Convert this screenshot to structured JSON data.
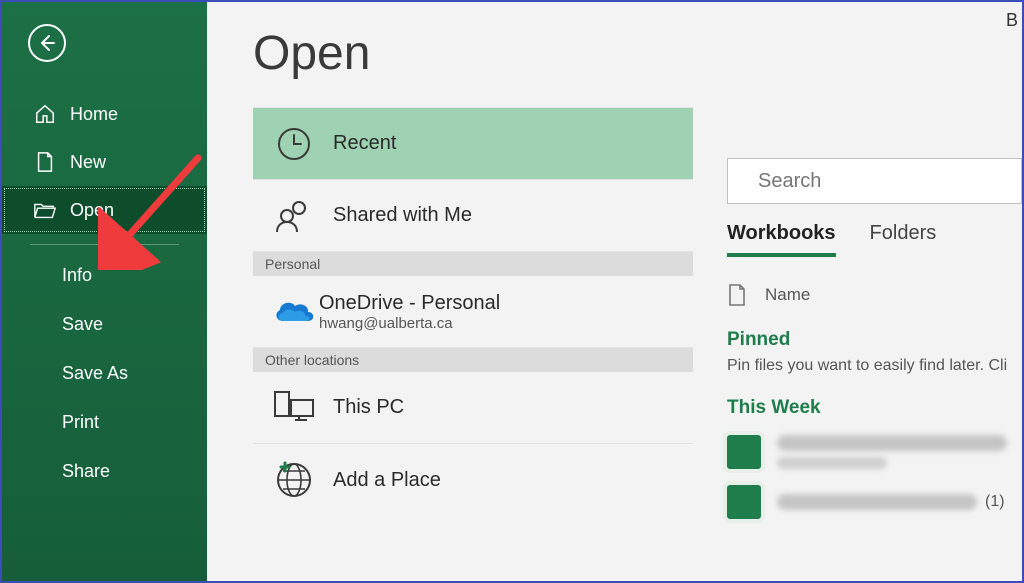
{
  "topRightFragment": "B",
  "sidebar": {
    "primary": [
      {
        "label": "Home",
        "icon": "home"
      },
      {
        "label": "New",
        "icon": "new"
      },
      {
        "label": "Open",
        "icon": "open",
        "selected": true
      }
    ],
    "secondary": [
      "Info",
      "Save",
      "Save As",
      "Print",
      "Share"
    ]
  },
  "page": {
    "title": "Open"
  },
  "locations": {
    "top": [
      {
        "label": "Recent",
        "icon": "recent",
        "selected": true
      },
      {
        "label": "Shared with Me",
        "icon": "shared"
      }
    ],
    "sections": [
      {
        "header": "Personal",
        "items": [
          {
            "label": "OneDrive - Personal",
            "sub": "hwang@ualberta.ca",
            "icon": "onedrive"
          }
        ]
      },
      {
        "header": "Other locations",
        "items": [
          {
            "label": "This PC",
            "icon": "thispc"
          },
          {
            "label": "Add a Place",
            "icon": "addplace"
          }
        ]
      }
    ]
  },
  "search": {
    "placeholder": "Search"
  },
  "tabs": {
    "items": [
      "Workbooks",
      "Folders"
    ],
    "active": 0
  },
  "list": {
    "columns": [
      "Name"
    ],
    "groups": [
      {
        "title": "Pinned",
        "hint": "Pin files you want to easily find later. Cli"
      },
      {
        "title": "This Week",
        "files": [
          {
            "suffix": ""
          },
          {
            "suffix": "(1)"
          }
        ]
      }
    ]
  }
}
